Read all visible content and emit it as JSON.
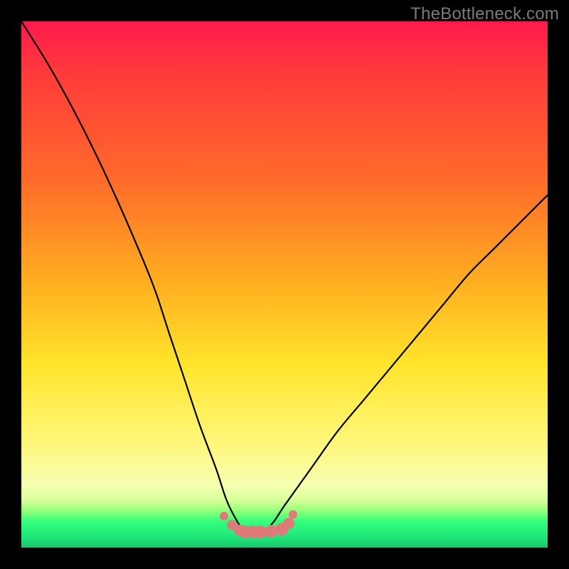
{
  "attribution": "TheBottleneck.com",
  "colors": {
    "frame": "#000000",
    "curve": "#000000",
    "marker_fill": "#e07a7a",
    "marker_stroke": "#c45f5f",
    "gradient_stops": [
      "#ff1a4d",
      "#ff3b3b",
      "#ff6a2a",
      "#ffb020",
      "#ffe42a",
      "#fff77a",
      "#f5ffb0",
      "#d7ff9a",
      "#93ff7a",
      "#35ff7a",
      "#1fe67a",
      "#17c76b"
    ]
  },
  "chart_data": {
    "type": "line",
    "title": "",
    "xlabel": "",
    "ylabel": "",
    "xlim": [
      0,
      100
    ],
    "ylim": [
      0,
      100
    ],
    "grid": false,
    "legend": false,
    "series": [
      {
        "name": "bottleneck-curve",
        "x": [
          0,
          5,
          10,
          15,
          20,
          25,
          28,
          31,
          34,
          37,
          39,
          41,
          42.5,
          44,
          46,
          48,
          50,
          55,
          60,
          65,
          70,
          75,
          80,
          85,
          90,
          95,
          100
        ],
        "y": [
          100,
          92,
          83,
          73,
          62,
          50,
          41,
          32,
          23,
          15,
          9,
          5,
          3,
          3,
          3,
          5,
          8,
          15,
          22,
          28,
          34,
          40,
          46,
          52,
          57,
          62,
          67
        ]
      }
    ],
    "markers": {
      "name": "floor-dots",
      "x": [
        38.5,
        40,
        41.5,
        42.5,
        44,
        45.5,
        47.5,
        49.5,
        50.8,
        51.6
      ],
      "y": [
        6,
        4.3,
        3.3,
        3,
        3,
        3,
        3.1,
        3.5,
        4.6,
        6.3
      ],
      "r": [
        6,
        7,
        8,
        9,
        9,
        9,
        9,
        9,
        8,
        6
      ]
    }
  }
}
